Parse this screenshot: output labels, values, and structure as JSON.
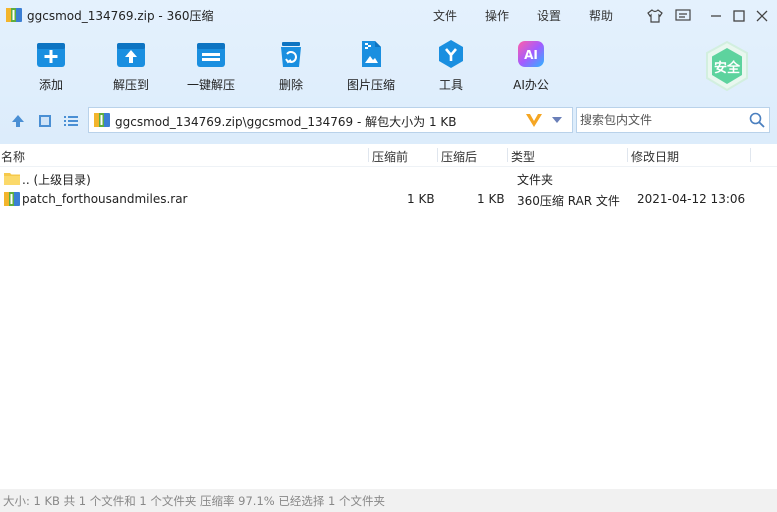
{
  "window": {
    "title": "ggcsmod_134769.zip - 360压缩",
    "menu": [
      "文件",
      "操作",
      "设置",
      "帮助"
    ]
  },
  "toolbar": {
    "items": [
      {
        "label": "添加",
        "icon": "add-archive-icon"
      },
      {
        "label": "解压到",
        "icon": "extract-to-icon"
      },
      {
        "label": "一键解压",
        "icon": "one-click-extract-icon"
      },
      {
        "label": "删除",
        "icon": "delete-icon"
      },
      {
        "label": "图片压缩",
        "icon": "image-compress-icon"
      },
      {
        "label": "工具",
        "icon": "tools-icon"
      },
      {
        "label": "AI办公",
        "icon": "ai-office-icon"
      }
    ],
    "security_badge": "安全"
  },
  "addressbar": {
    "path": "ggcsmod_134769.zip\\ggcsmod_134769 - 解包大小为 1 KB",
    "search_placeholder": "搜索包内文件"
  },
  "filelist": {
    "columns": [
      "名称",
      "压缩前",
      "压缩后",
      "类型",
      "修改日期"
    ],
    "rows": [
      {
        "name": ".. (上级目录)",
        "before": "",
        "after": "",
        "type": "文件夹",
        "date": "",
        "icon": "folder-icon"
      },
      {
        "name": "patch_forthousandmiles.rar",
        "before": "1 KB",
        "after": "1 KB",
        "type": "360压缩 RAR 文件",
        "date": "2021-04-12 13:06",
        "icon": "rar-file-icon"
      }
    ]
  },
  "statusbar": {
    "text": "大小: 1 KB 共 1 个文件和 1 个文件夹 压缩率 97.1% 已经选择 1 个文件夹"
  },
  "colors": {
    "toolbar_bg": "#dcecfb",
    "icon_blue": "#1a8fe0",
    "safe_green": "#5dd39e"
  }
}
